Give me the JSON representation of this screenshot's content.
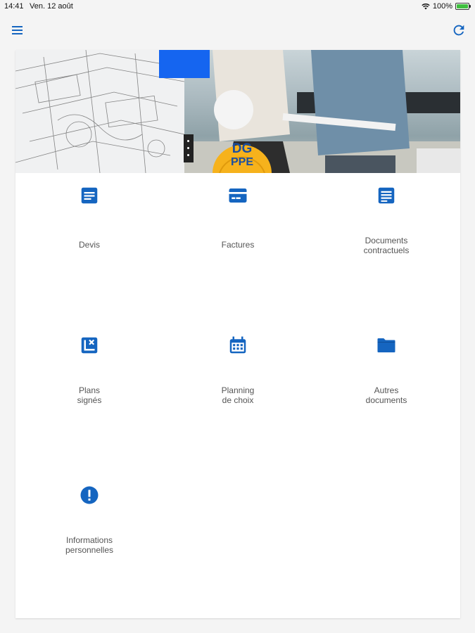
{
  "status_bar": {
    "time": "14:41",
    "date": "Ven. 12 août",
    "battery": "100%"
  },
  "app_bar": {
    "menu_icon": "menu-icon",
    "refresh_icon": "refresh-icon"
  },
  "banner": {
    "helmet_line1": "DG",
    "helmet_line2": "PPE"
  },
  "colors": {
    "accent": "#1565c0",
    "banner_square": "#1565f0",
    "helmet": "#f6b21c"
  },
  "tiles": [
    {
      "label": "Devis",
      "icon": "document-icon"
    },
    {
      "label": "Factures",
      "icon": "invoice-card-icon"
    },
    {
      "label": "Documents\ncontractuels",
      "icon": "contract-document-icon"
    },
    {
      "label": "Plans\nsignés",
      "icon": "signed-plan-icon"
    },
    {
      "label": "Planning\nde choix",
      "icon": "calendar-icon"
    },
    {
      "label": "Autres\ndocuments",
      "icon": "folder-icon"
    },
    {
      "label": "Informations\npersonnelles",
      "icon": "info-icon"
    }
  ]
}
